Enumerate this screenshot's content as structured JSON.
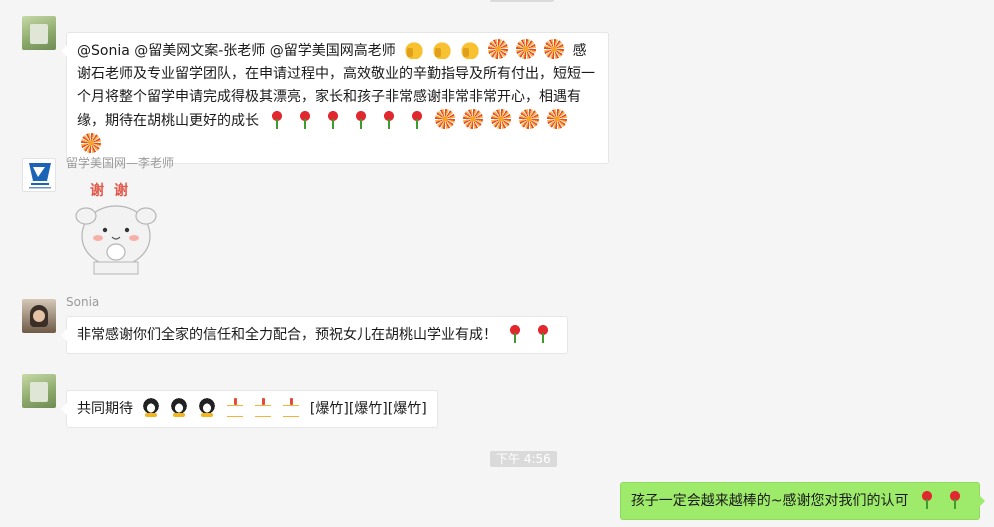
{
  "messages": [
    {
      "sender": "",
      "text": "@Sonia @留美网文案-张老师 @留学美国网高老师",
      "text2": "感谢石老师及专业留学团队，在申请过程中，高效敬业的辛勤指导及所有付出，短短一个月将整个留学申请完成得极其漂亮，家长和孩子非常感谢非常非常开心，相遇有缘，期待在胡桃山更好的成长"
    },
    {
      "sender": "留学美国网—李老师",
      "sticker_text": "谢谢"
    },
    {
      "sender": "Sonia",
      "text": "非常感谢你们全家的信任和全力配合，预祝女儿在胡桃山学业有成！"
    },
    {
      "sender": "",
      "text": "共同期待",
      "text2": "[爆竹][爆竹][爆竹]"
    },
    {
      "timestamp": "下午 4:56"
    },
    {
      "sender": "me",
      "text": "孩子一定会越来越棒的~感谢您对我们的认可"
    }
  ],
  "icons": {
    "thumb": "thumbs-up-icon",
    "firework": "firework-icon",
    "rose": "rose-icon",
    "penguin": "penguin-icon",
    "cake": "cake-icon"
  },
  "colors": {
    "my_bubble": "#9eea6a",
    "their_bubble": "#ffffff",
    "background": "#f5f5f5"
  }
}
